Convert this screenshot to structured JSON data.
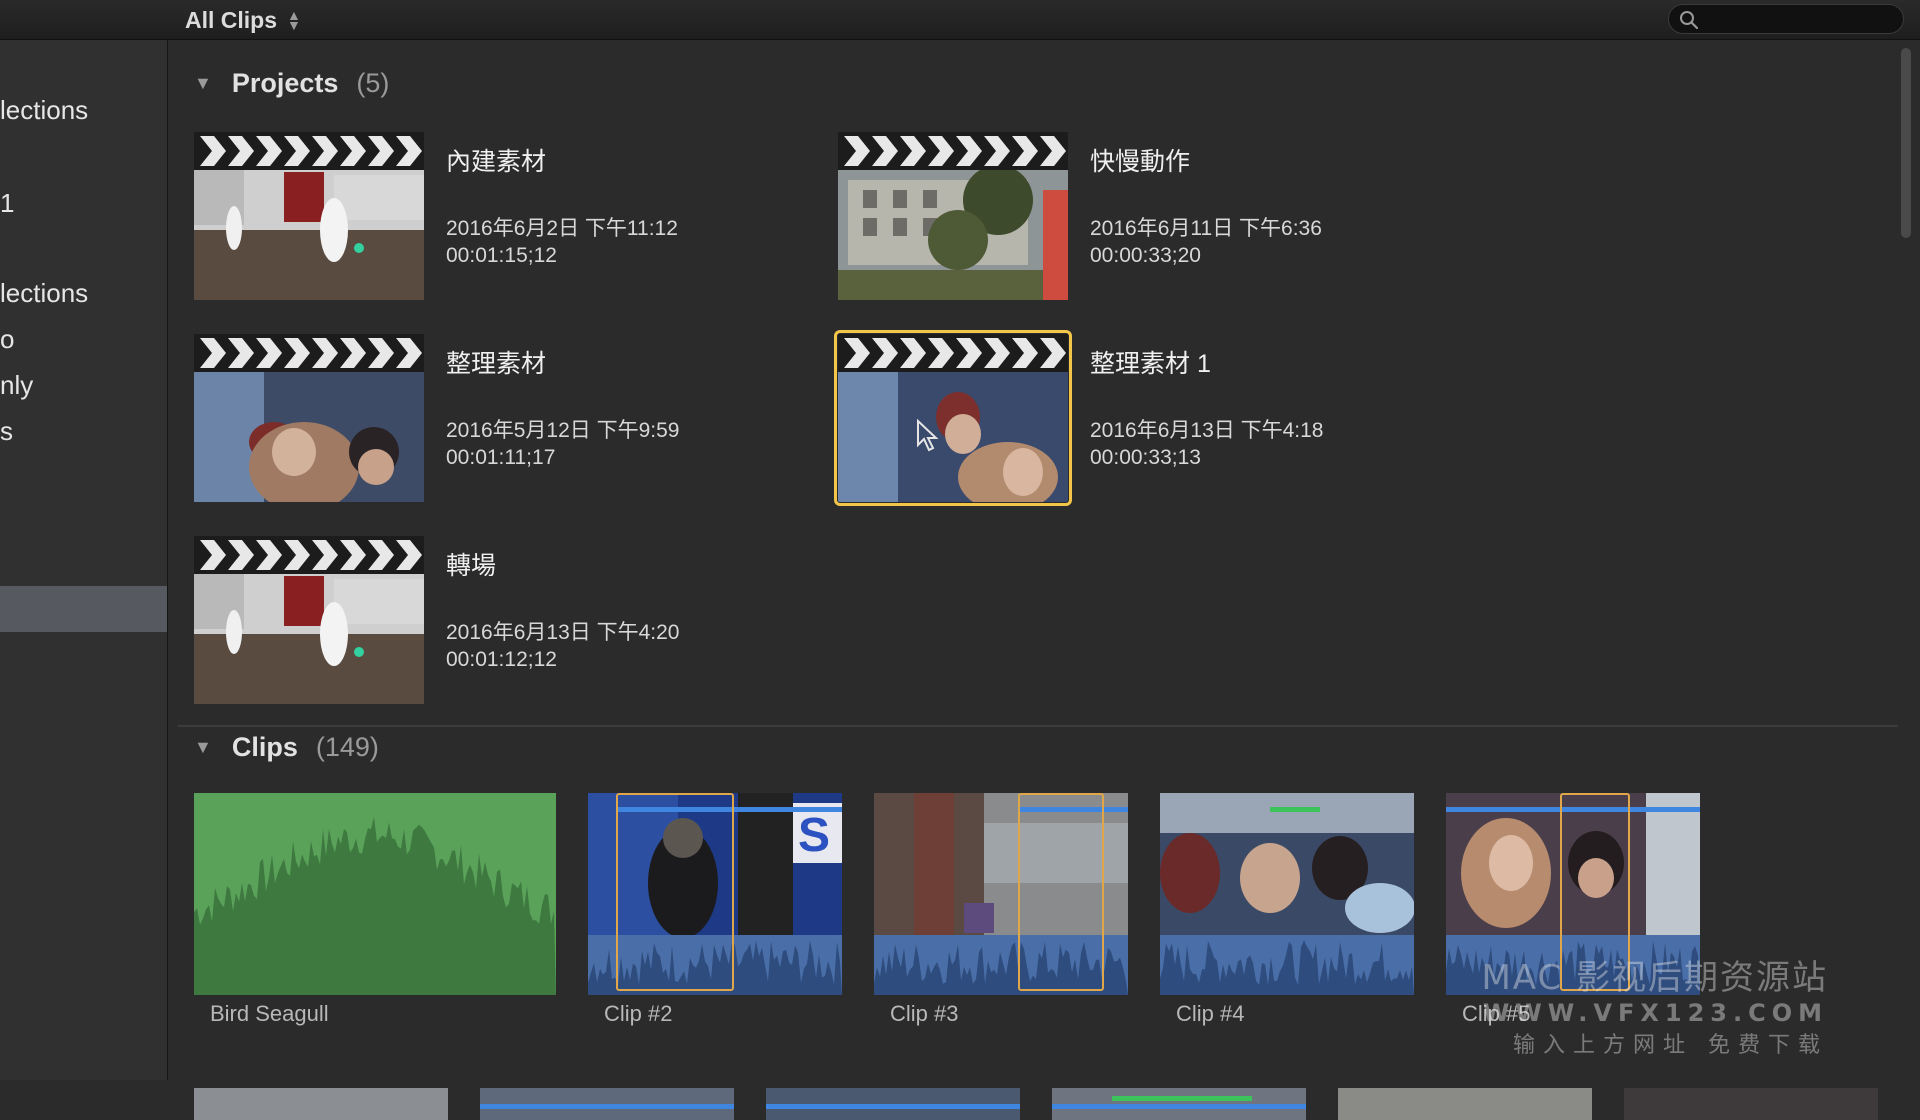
{
  "toolbar": {
    "filter_label": "All Clips",
    "search_placeholder": "",
    "icons": {
      "filter": "updown-chevron-icon",
      "search": "search-icon"
    }
  },
  "sidebar": {
    "items": [
      {
        "label": "lections"
      },
      {
        "label": "1"
      },
      {
        "label": "lections"
      },
      {
        "label": "o"
      },
      {
        "label": "nly"
      },
      {
        "label": "s"
      }
    ]
  },
  "projects": {
    "title": "Projects",
    "count": "(5)",
    "items": [
      {
        "name": "內建素材",
        "date": "2016年6月2日 下午11:12",
        "duration": "00:01:15;12"
      },
      {
        "name": "快慢動作",
        "date": "2016年6月11日 下午6:36",
        "duration": "00:00:33;20"
      },
      {
        "name": "整理素材",
        "date": "2016年5月12日 下午9:59",
        "duration": "00:01:11;17"
      },
      {
        "name": "整理素材 1",
        "date": "2016年6月13日 下午4:18",
        "duration": "00:00:33;13",
        "selected": true
      },
      {
        "name": "轉場",
        "date": "2016年6月13日 下午4:20",
        "duration": "00:01:12;12"
      }
    ]
  },
  "clips": {
    "title": "Clips",
    "count": "(149)",
    "items": [
      {
        "label": "Bird Seagull"
      },
      {
        "label": "Clip #2"
      },
      {
        "label": "Clip #3"
      },
      {
        "label": "Clip #4"
      },
      {
        "label": "Clip #5"
      }
    ]
  },
  "colors": {
    "selection": "#f3c64a",
    "range": "#e0a64a",
    "keyword_bar": "#3f86e0",
    "favorite_bar": "#3cc45a",
    "audio_wave": "#5aa25a",
    "clip_audio": "#4a6fa8"
  },
  "watermark": {
    "line1": "MAC 影视后期资源站",
    "line2": "WWW.VFX123.COM",
    "line3": "输入上方网址 免费下载"
  }
}
